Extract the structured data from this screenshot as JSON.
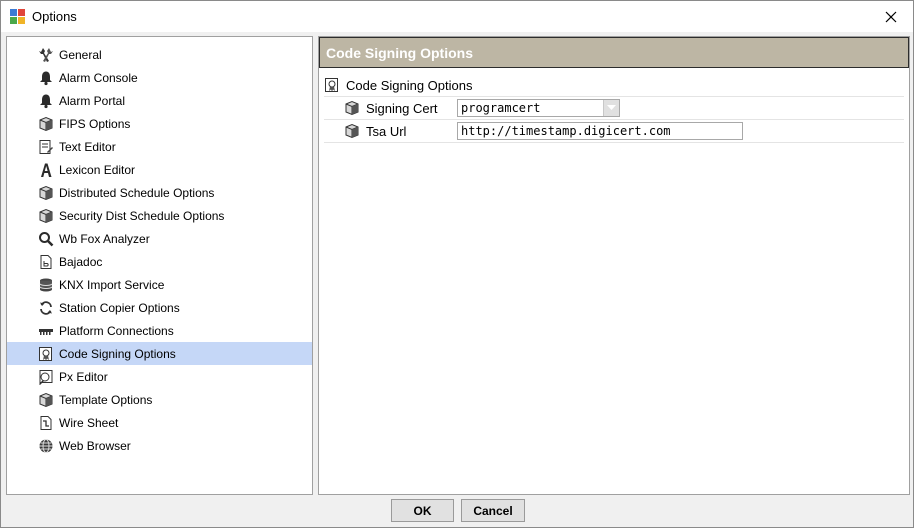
{
  "window": {
    "title": "Options"
  },
  "sidebar": {
    "items": [
      {
        "label": "General",
        "icon": "wrench-icon"
      },
      {
        "label": "Alarm Console",
        "icon": "bell-icon"
      },
      {
        "label": "Alarm Portal",
        "icon": "bell-icon"
      },
      {
        "label": "FIPS Options",
        "icon": "cube-icon"
      },
      {
        "label": "Text Editor",
        "icon": "text-edit-icon"
      },
      {
        "label": "Lexicon Editor",
        "icon": "letter-a-icon"
      },
      {
        "label": "Distributed Schedule Options",
        "icon": "cube-icon"
      },
      {
        "label": "Security Dist Schedule Options",
        "icon": "cube-icon"
      },
      {
        "label": "Wb Fox Analyzer",
        "icon": "magnifier-icon"
      },
      {
        "label": "Bajadoc",
        "icon": "doc-icon"
      },
      {
        "label": "KNX Import Service",
        "icon": "database-icon"
      },
      {
        "label": "Station Copier Options",
        "icon": "sync-icon"
      },
      {
        "label": "Platform Connections",
        "icon": "connector-icon"
      },
      {
        "label": "Code Signing Options",
        "icon": "certificate-icon"
      },
      {
        "label": "Px Editor",
        "icon": "px-editor-icon"
      },
      {
        "label": "Template Options",
        "icon": "cube-icon"
      },
      {
        "label": "Wire Sheet",
        "icon": "wire-sheet-icon"
      },
      {
        "label": "Web Browser",
        "icon": "globe-icon"
      }
    ],
    "selected_index": 13
  },
  "main": {
    "header_title": "Code Signing Options",
    "root_label": "Code Signing Options",
    "properties": [
      {
        "label": "Signing Cert",
        "value": "programcert",
        "kind": "select"
      },
      {
        "label": "Tsa Url",
        "value": "http://timestamp.digicert.com",
        "kind": "text"
      }
    ]
  },
  "buttons": {
    "ok": "OK",
    "cancel": "Cancel"
  },
  "colors": {
    "header_bg": "#bdb6a4",
    "selected_bg": "#c5d7f7"
  }
}
